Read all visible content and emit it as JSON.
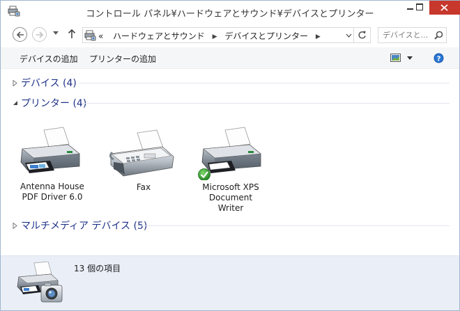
{
  "window": {
    "title": "コントロール パネル¥ハードウェアとサウンド¥デバイスとプリンター",
    "app_icon": "devices-printers-icon"
  },
  "address_bar": {
    "overflow_label": "«",
    "crumbs": [
      "ハードウェアとサウンド",
      "デバイスとプリンター"
    ],
    "search_placeholder": "デバイスと..."
  },
  "command_bar": {
    "add_device": "デバイスの追加",
    "add_printer": "プリンターの追加"
  },
  "groups": [
    {
      "title": "デバイス (4)",
      "expanded": false
    },
    {
      "title": "プリンター (4)",
      "expanded": true
    },
    {
      "title": "マルチメディア デバイス (5)",
      "expanded": false
    }
  ],
  "printers": [
    {
      "label_lines": [
        "Antenna House",
        "PDF Driver 6.0"
      ],
      "icon": "printer-icon",
      "default": false
    },
    {
      "label_lines": [
        "Fax"
      ],
      "icon": "fax-icon",
      "default": false
    },
    {
      "label_lines": [
        "Microsoft XPS",
        "Document",
        "Writer"
      ],
      "icon": "printer-icon",
      "default": true
    }
  ],
  "details": {
    "count_text": "13 個の項目",
    "icon": "devices-printers-icon"
  },
  "colors": {
    "group_title": "#1e3287",
    "close_button": "#c7372c",
    "details_bg": "#e9eef7",
    "default_check": "#2e9a2a"
  }
}
